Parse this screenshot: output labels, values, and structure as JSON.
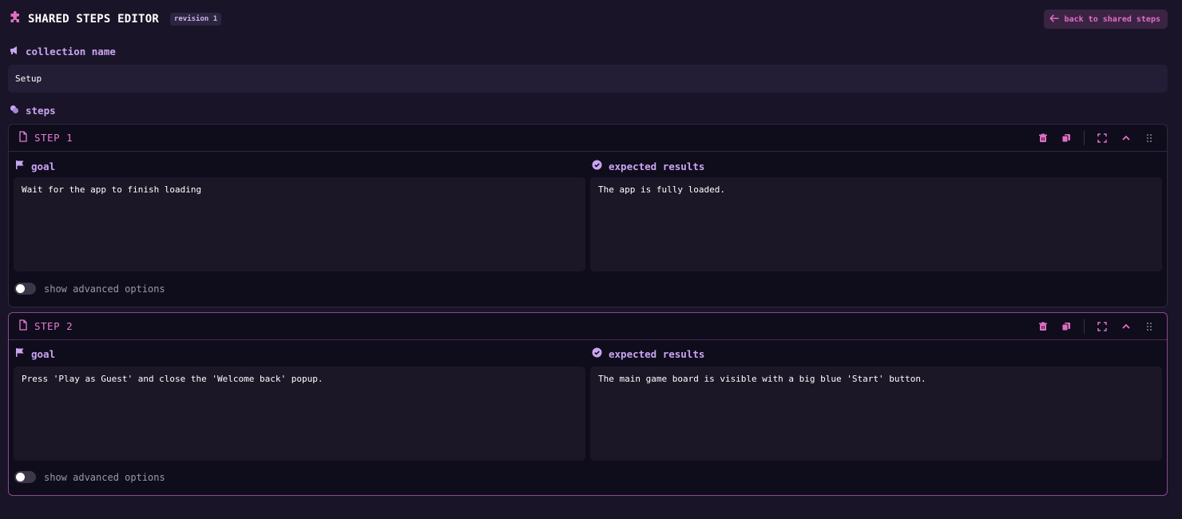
{
  "header": {
    "title": "SHARED STEPS EDITOR",
    "revision": "revision 1",
    "back_label": "back to shared steps",
    "icon": "puzzle-icon"
  },
  "collection": {
    "label": "collection name",
    "value": "Setup"
  },
  "steps_label": "steps",
  "steps": [
    {
      "title": "STEP 1",
      "goal_label": "goal",
      "goal": "Wait for the app to finish loading",
      "expected_label": "expected results",
      "expected": "The app is fully loaded.",
      "advanced_label": "show advanced options",
      "advanced_on": false
    },
    {
      "title": "STEP 2",
      "goal_label": "goal",
      "goal": "Press 'Play as Guest' and close the 'Welcome back' popup.",
      "expected_label": "expected results",
      "expected": "The main game board is visible with a big blue 'Start' button.",
      "advanced_label": "show advanced options",
      "advanced_on": false
    }
  ],
  "colors": {
    "background": "#1a1428",
    "accent_pink": "#e67ad2",
    "accent_purple": "#c9a6f0"
  }
}
